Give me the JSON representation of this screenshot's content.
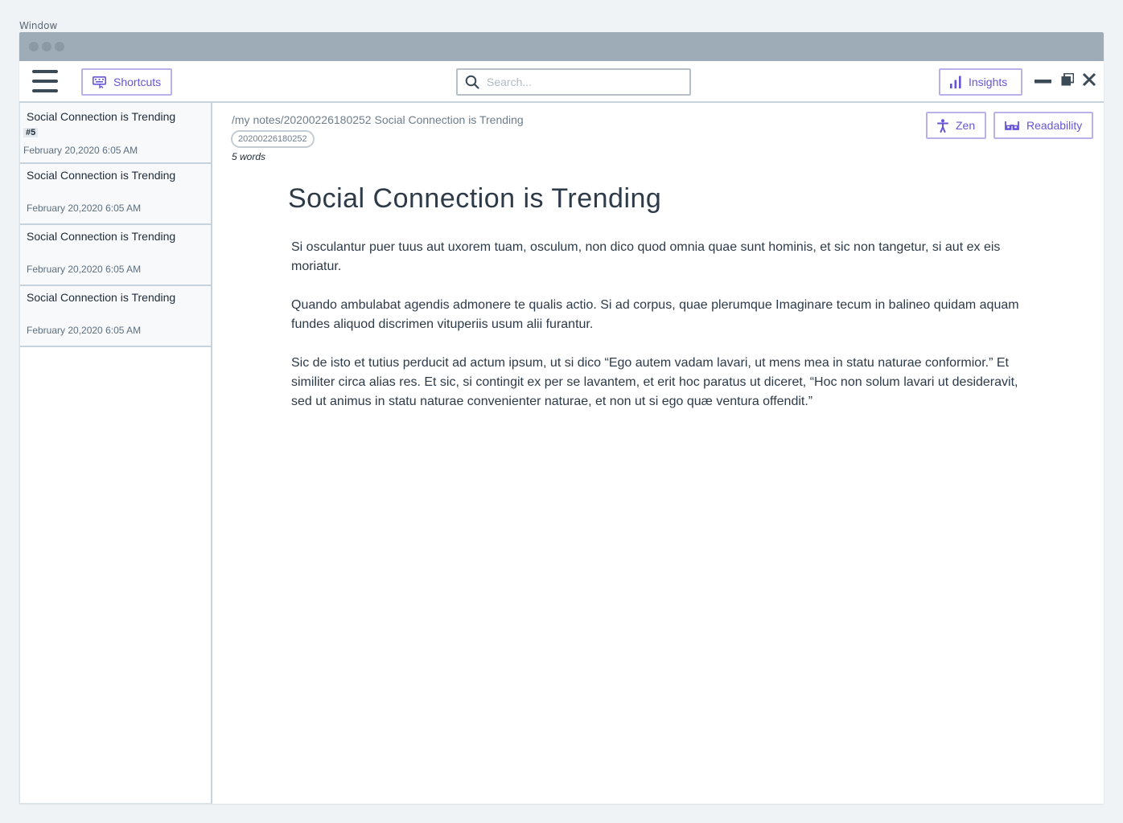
{
  "caption": "Window",
  "toolbar": {
    "shortcuts_label": "Shortcuts",
    "search_placeholder": "Search...",
    "insights_label": "Insights"
  },
  "sidebar": {
    "items": [
      {
        "title": "Social Connection is Trending",
        "tag": "#5",
        "date": "February 20,2020 6:05 AM"
      },
      {
        "title": "Social Connection is Trending",
        "date": "February 20,2020 6:05 AM"
      },
      {
        "title": "Social Connection is Trending",
        "date": "February 20,2020 6:05 AM"
      },
      {
        "title": "Social Connection is Trending",
        "date": "February 20,2020 6:05 AM"
      }
    ]
  },
  "note": {
    "path": "/my notes/20200226180252 Social Connection is Trending",
    "id": "20200226180252",
    "word_count": "5 words",
    "zen_label": "Zen",
    "readability_label": "Readability",
    "title": "Social Connection is Trending",
    "paragraphs": [
      "Si osculantur puer tuus aut uxorem tuam, osculum, non dico quod omnia quae sunt hominis, et sic non tangetur, si aut ex eis moriatur.",
      "Quando ambulabat agendis admonere te qualis actio. Si ad corpus, quae plerumque Imaginare tecum in balineo quidam aquam fundes aliquod discrimen vituperiis usum alii furantur.",
      "Sic de isto et tutius perducit ad actum ipsum, ut si dico “Ego autem vadam lavari, ut mens mea in statu naturae conformior.” Et similiter circa alias res. Et sic, si contingit ex per se lavantem, et erit hoc paratus ut diceret, “Hoc non solum lavari ut desideravit, sed ut animus in statu naturae convenienter naturae, et non ut si ego quæ ventura offendit.”"
    ]
  },
  "colors": {
    "accent": "#6655d6",
    "titlebar": "#9eacb8",
    "border": "#c6d2dc"
  }
}
